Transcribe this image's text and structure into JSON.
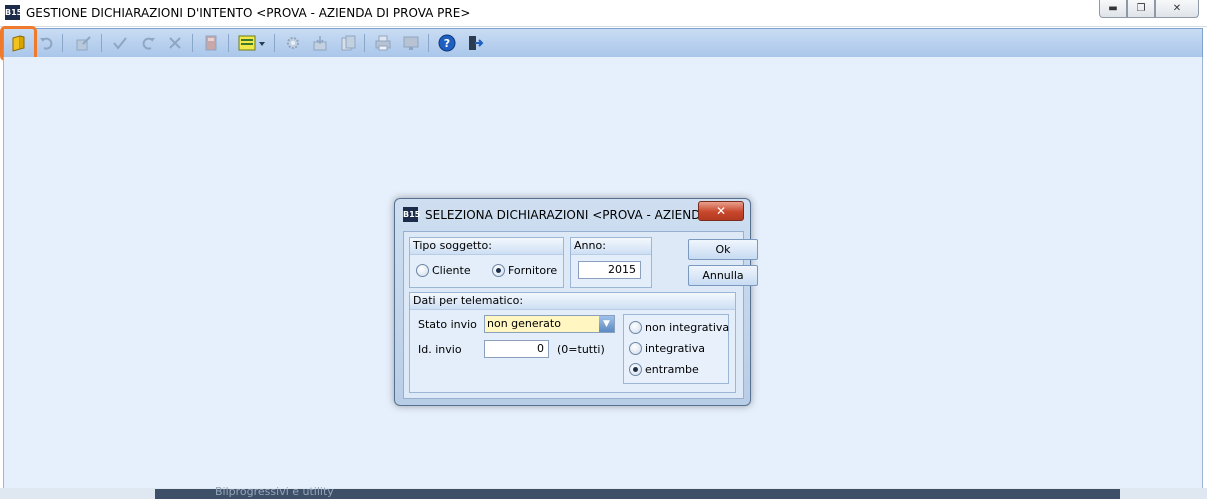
{
  "window": {
    "title": "GESTIONE DICHIARAZIONI D'INTENTO <PROVA - AZIENDA DI PROVA PRE>",
    "logo": "B15"
  },
  "background": {
    "partial_text": "Bilprogressivi e utility"
  },
  "dialog": {
    "title": "SELEZIONA DICHIARAZIONI <PROVA - AZIENDA ...",
    "logo": "B15",
    "tipo_soggetto": {
      "label": "Tipo soggetto:",
      "options": [
        "Cliente",
        "Fornitore"
      ],
      "selected": "Fornitore"
    },
    "anno": {
      "label": "Anno:",
      "value": "2015"
    },
    "buttons": {
      "ok": "Ok",
      "annulla": "Annulla"
    },
    "dati_telematico": {
      "label": "Dati per telematico:",
      "stato_invio_label": "Stato invio",
      "stato_invio_value": "non generato",
      "id_invio_label": "Id. invio",
      "id_invio_value": "0",
      "id_invio_hint": "(0=tutti)",
      "integrativa_options": [
        "non integrativa",
        "integrativa",
        "entrambe"
      ],
      "integrativa_selected": "entrambe"
    }
  },
  "toolbar_icons": [
    "new-folder-icon",
    "undo-icon",
    "edit-icon",
    "confirm-icon",
    "redo-icon",
    "delete-icon",
    "book-icon",
    "list-dropdown-icon",
    "settings-icon",
    "import-icon",
    "export-icon",
    "print-icon",
    "monitor-icon",
    "help-icon",
    "exit-icon"
  ],
  "colors": {
    "highlight": "#f07a2b",
    "workspace": "#e6f0fc",
    "select_bg": "#fff6c2"
  }
}
